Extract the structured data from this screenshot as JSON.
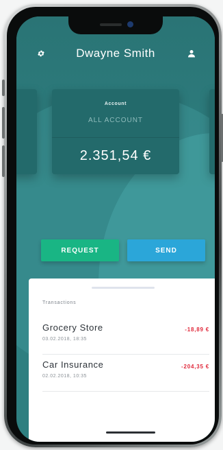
{
  "header": {
    "title": "Dwayne Smith",
    "settings_icon": "gear-icon",
    "profile_icon": "user-icon"
  },
  "account_card": {
    "label": "Account",
    "subtitle": "ALL ACCOUNT",
    "balance": "2.351,54 €"
  },
  "actions": {
    "request_label": "REQUEST",
    "send_label": "SEND"
  },
  "transactions": {
    "title": "Transactions",
    "items": [
      {
        "name": "Grocery Store",
        "date": "03.02.2018, 18:35",
        "amount": "-18,89 €"
      },
      {
        "name": "Car Insurance",
        "date": "02.02.2018, 10:35",
        "amount": "-204,35 €"
      }
    ]
  },
  "colors": {
    "primary": "#2e7f80",
    "card": "#236a6b",
    "request": "#19b584",
    "send": "#2ba6d9",
    "negative": "#e0283a"
  }
}
